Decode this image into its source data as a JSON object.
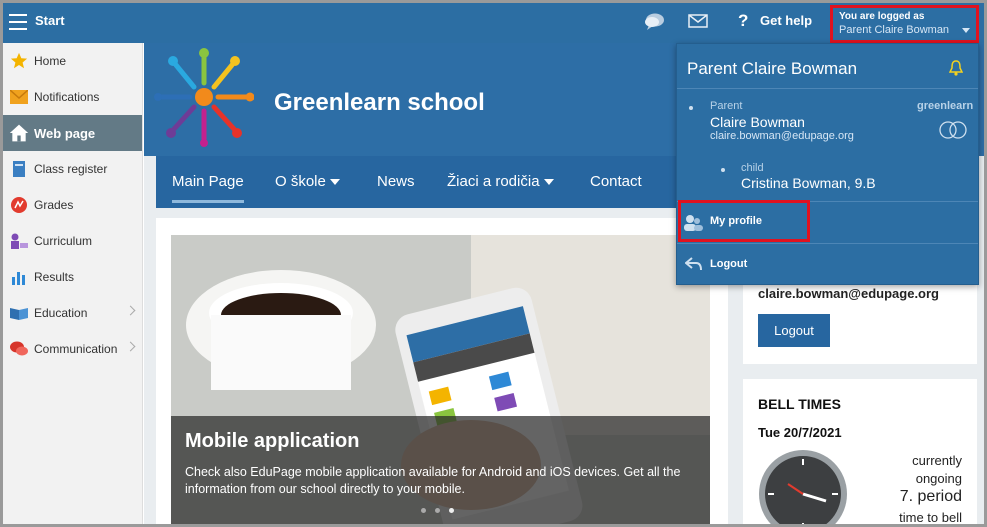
{
  "topbar": {
    "start_label": "Start",
    "help_label": "Get help",
    "help_glyph": "?",
    "user_label": "You are logged as",
    "user_name": "Parent Claire Bowman",
    "icons": [
      "menu-icon",
      "chat-icon",
      "mail-icon",
      "help-icon",
      "chevron-down-icon"
    ],
    "accent": "#2c6ea3",
    "highlight": "#e0121f"
  },
  "sidebar": {
    "items": [
      {
        "label": "Home",
        "icon": "star-icon"
      },
      {
        "label": "Notifications",
        "icon": "envelope-icon"
      },
      {
        "label": "Web page",
        "icon": "house-icon",
        "active": true
      },
      {
        "label": "Class register",
        "icon": "book-icon"
      },
      {
        "label": "Grades",
        "icon": "grades-icon"
      },
      {
        "label": "Curriculum",
        "icon": "teacher-icon"
      },
      {
        "label": "Results",
        "icon": "bar-chart-icon"
      },
      {
        "label": "Education",
        "icon": "open-book-icon",
        "submenu": true
      },
      {
        "label": "Communication",
        "icon": "speech-bubbles-icon",
        "submenu": true
      }
    ],
    "active_color": "#637a86"
  },
  "banner": {
    "school_name": "Greenlearn school"
  },
  "nav": {
    "items": [
      "Main Page",
      "O škole",
      "News",
      "Žiaci a rodičia",
      "Contact"
    ]
  },
  "slide": {
    "title": "Mobile application",
    "text": "Check also EduPage mobile application available for Android and iOS devices. Get all the information from our school directly to your mobile.",
    "slide_count": 3,
    "active_slide": 3
  },
  "login_card": {
    "email": "claire.bowman@edupage.org",
    "logout_label": "Logout"
  },
  "bell": {
    "title": "BELL TIMES",
    "date": "Tue 20/7/2021",
    "currently": "currently",
    "ongoing": "ongoing",
    "period": "7. period",
    "time_to_bell": "time to bell"
  },
  "dropdown": {
    "name": "Parent Claire Bowman",
    "role": "Parent",
    "person": "Claire Bowman",
    "email": "claire.bowman@edupage.org",
    "school_tag": "greenlearn",
    "child_role": "child",
    "child_name": "Cristina Bowman, 9.B",
    "my_profile": "My profile",
    "logout": "Logout"
  }
}
